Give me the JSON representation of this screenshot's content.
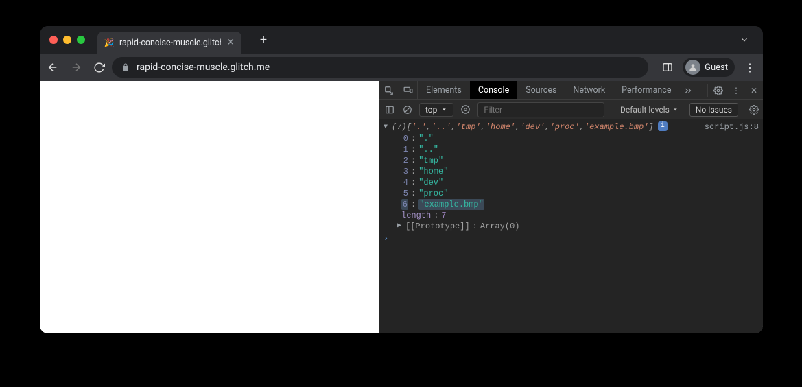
{
  "tab": {
    "title": "rapid-concise-muscle.glitch.me",
    "favicon": "🎉"
  },
  "omnibox": {
    "url": "rapid-concise-muscle.glitch.me"
  },
  "profile": {
    "label": "Guest"
  },
  "devtools": {
    "tabs": {
      "elements": "Elements",
      "console": "Console",
      "sources": "Sources",
      "network": "Network",
      "performance": "Performance"
    },
    "console": {
      "context": "top",
      "filter_placeholder": "Filter",
      "levels_label": "Default levels",
      "issues_label": "No Issues"
    },
    "log": {
      "length": 7,
      "summary_items": [
        "'.'",
        "'..'",
        "'tmp'",
        "'home'",
        "'dev'",
        "'proc'",
        "'example.bmp'"
      ],
      "items": [
        ".",
        "..",
        "tmp",
        "home",
        "dev",
        "proc",
        "example.bmp"
      ],
      "highlight_index": 6,
      "length_label": "length",
      "length_value": "7",
      "prototype_label": "[[Prototype]]",
      "prototype_value": "Array(0)",
      "source": "script.js:8"
    }
  }
}
